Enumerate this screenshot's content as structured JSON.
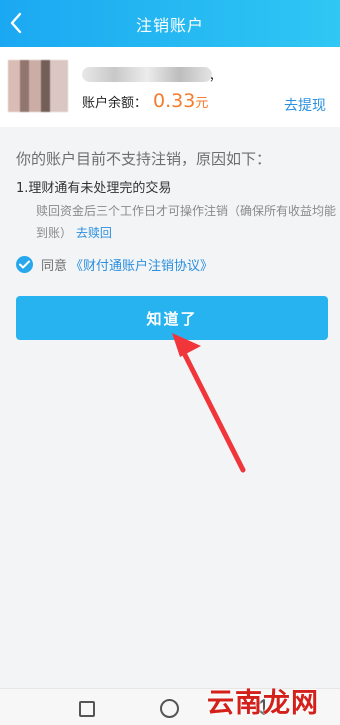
{
  "header": {
    "title": "注销账户"
  },
  "account": {
    "name_tail": "，",
    "balance_label": "账户余额：",
    "balance_amount": "0.33",
    "balance_unit": "元",
    "withdraw_label": "去提现"
  },
  "message": {
    "title": "你的账户目前不支持注销，原因如下：",
    "reason_title": "1.理财通有未处理完的交易",
    "reason_desc": "赎回资金后三个工作日才可操作注销（确保所有收益均能到账）",
    "reason_link": "去赎回"
  },
  "agreement": {
    "prefix": "同意",
    "link": "《财付通账户注销协议》"
  },
  "button": {
    "label": "知道了"
  },
  "watermark": {
    "text": "云南龙网"
  },
  "colors": {
    "accent": "#27b3f0",
    "header": "#1ba8f2",
    "amount": "#f47c2c",
    "link": "#2a8fe0",
    "annotation_arrow": "#f0363a"
  }
}
